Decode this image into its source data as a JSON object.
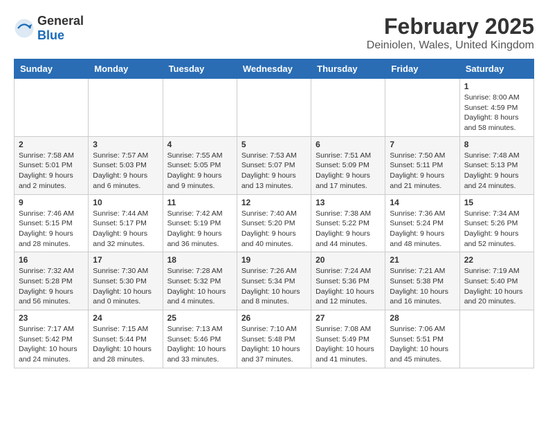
{
  "header": {
    "logo": {
      "general": "General",
      "blue": "Blue"
    },
    "title": "February 2025",
    "location": "Deiniolen, Wales, United Kingdom"
  },
  "calendar": {
    "weekdays": [
      "Sunday",
      "Monday",
      "Tuesday",
      "Wednesday",
      "Thursday",
      "Friday",
      "Saturday"
    ],
    "weeks": [
      [
        {
          "day": "",
          "info": ""
        },
        {
          "day": "",
          "info": ""
        },
        {
          "day": "",
          "info": ""
        },
        {
          "day": "",
          "info": ""
        },
        {
          "day": "",
          "info": ""
        },
        {
          "day": "",
          "info": ""
        },
        {
          "day": "1",
          "info": "Sunrise: 8:00 AM\nSunset: 4:59 PM\nDaylight: 8 hours and 58 minutes."
        }
      ],
      [
        {
          "day": "2",
          "info": "Sunrise: 7:58 AM\nSunset: 5:01 PM\nDaylight: 9 hours and 2 minutes."
        },
        {
          "day": "3",
          "info": "Sunrise: 7:57 AM\nSunset: 5:03 PM\nDaylight: 9 hours and 6 minutes."
        },
        {
          "day": "4",
          "info": "Sunrise: 7:55 AM\nSunset: 5:05 PM\nDaylight: 9 hours and 9 minutes."
        },
        {
          "day": "5",
          "info": "Sunrise: 7:53 AM\nSunset: 5:07 PM\nDaylight: 9 hours and 13 minutes."
        },
        {
          "day": "6",
          "info": "Sunrise: 7:51 AM\nSunset: 5:09 PM\nDaylight: 9 hours and 17 minutes."
        },
        {
          "day": "7",
          "info": "Sunrise: 7:50 AM\nSunset: 5:11 PM\nDaylight: 9 hours and 21 minutes."
        },
        {
          "day": "8",
          "info": "Sunrise: 7:48 AM\nSunset: 5:13 PM\nDaylight: 9 hours and 24 minutes."
        }
      ],
      [
        {
          "day": "9",
          "info": "Sunrise: 7:46 AM\nSunset: 5:15 PM\nDaylight: 9 hours and 28 minutes."
        },
        {
          "day": "10",
          "info": "Sunrise: 7:44 AM\nSunset: 5:17 PM\nDaylight: 9 hours and 32 minutes."
        },
        {
          "day": "11",
          "info": "Sunrise: 7:42 AM\nSunset: 5:19 PM\nDaylight: 9 hours and 36 minutes."
        },
        {
          "day": "12",
          "info": "Sunrise: 7:40 AM\nSunset: 5:20 PM\nDaylight: 9 hours and 40 minutes."
        },
        {
          "day": "13",
          "info": "Sunrise: 7:38 AM\nSunset: 5:22 PM\nDaylight: 9 hours and 44 minutes."
        },
        {
          "day": "14",
          "info": "Sunrise: 7:36 AM\nSunset: 5:24 PM\nDaylight: 9 hours and 48 minutes."
        },
        {
          "day": "15",
          "info": "Sunrise: 7:34 AM\nSunset: 5:26 PM\nDaylight: 9 hours and 52 minutes."
        }
      ],
      [
        {
          "day": "16",
          "info": "Sunrise: 7:32 AM\nSunset: 5:28 PM\nDaylight: 9 hours and 56 minutes."
        },
        {
          "day": "17",
          "info": "Sunrise: 7:30 AM\nSunset: 5:30 PM\nDaylight: 10 hours and 0 minutes."
        },
        {
          "day": "18",
          "info": "Sunrise: 7:28 AM\nSunset: 5:32 PM\nDaylight: 10 hours and 4 minutes."
        },
        {
          "day": "19",
          "info": "Sunrise: 7:26 AM\nSunset: 5:34 PM\nDaylight: 10 hours and 8 minutes."
        },
        {
          "day": "20",
          "info": "Sunrise: 7:24 AM\nSunset: 5:36 PM\nDaylight: 10 hours and 12 minutes."
        },
        {
          "day": "21",
          "info": "Sunrise: 7:21 AM\nSunset: 5:38 PM\nDaylight: 10 hours and 16 minutes."
        },
        {
          "day": "22",
          "info": "Sunrise: 7:19 AM\nSunset: 5:40 PM\nDaylight: 10 hours and 20 minutes."
        }
      ],
      [
        {
          "day": "23",
          "info": "Sunrise: 7:17 AM\nSunset: 5:42 PM\nDaylight: 10 hours and 24 minutes."
        },
        {
          "day": "24",
          "info": "Sunrise: 7:15 AM\nSunset: 5:44 PM\nDaylight: 10 hours and 28 minutes."
        },
        {
          "day": "25",
          "info": "Sunrise: 7:13 AM\nSunset: 5:46 PM\nDaylight: 10 hours and 33 minutes."
        },
        {
          "day": "26",
          "info": "Sunrise: 7:10 AM\nSunset: 5:48 PM\nDaylight: 10 hours and 37 minutes."
        },
        {
          "day": "27",
          "info": "Sunrise: 7:08 AM\nSunset: 5:49 PM\nDaylight: 10 hours and 41 minutes."
        },
        {
          "day": "28",
          "info": "Sunrise: 7:06 AM\nSunset: 5:51 PM\nDaylight: 10 hours and 45 minutes."
        },
        {
          "day": "",
          "info": ""
        }
      ]
    ]
  }
}
